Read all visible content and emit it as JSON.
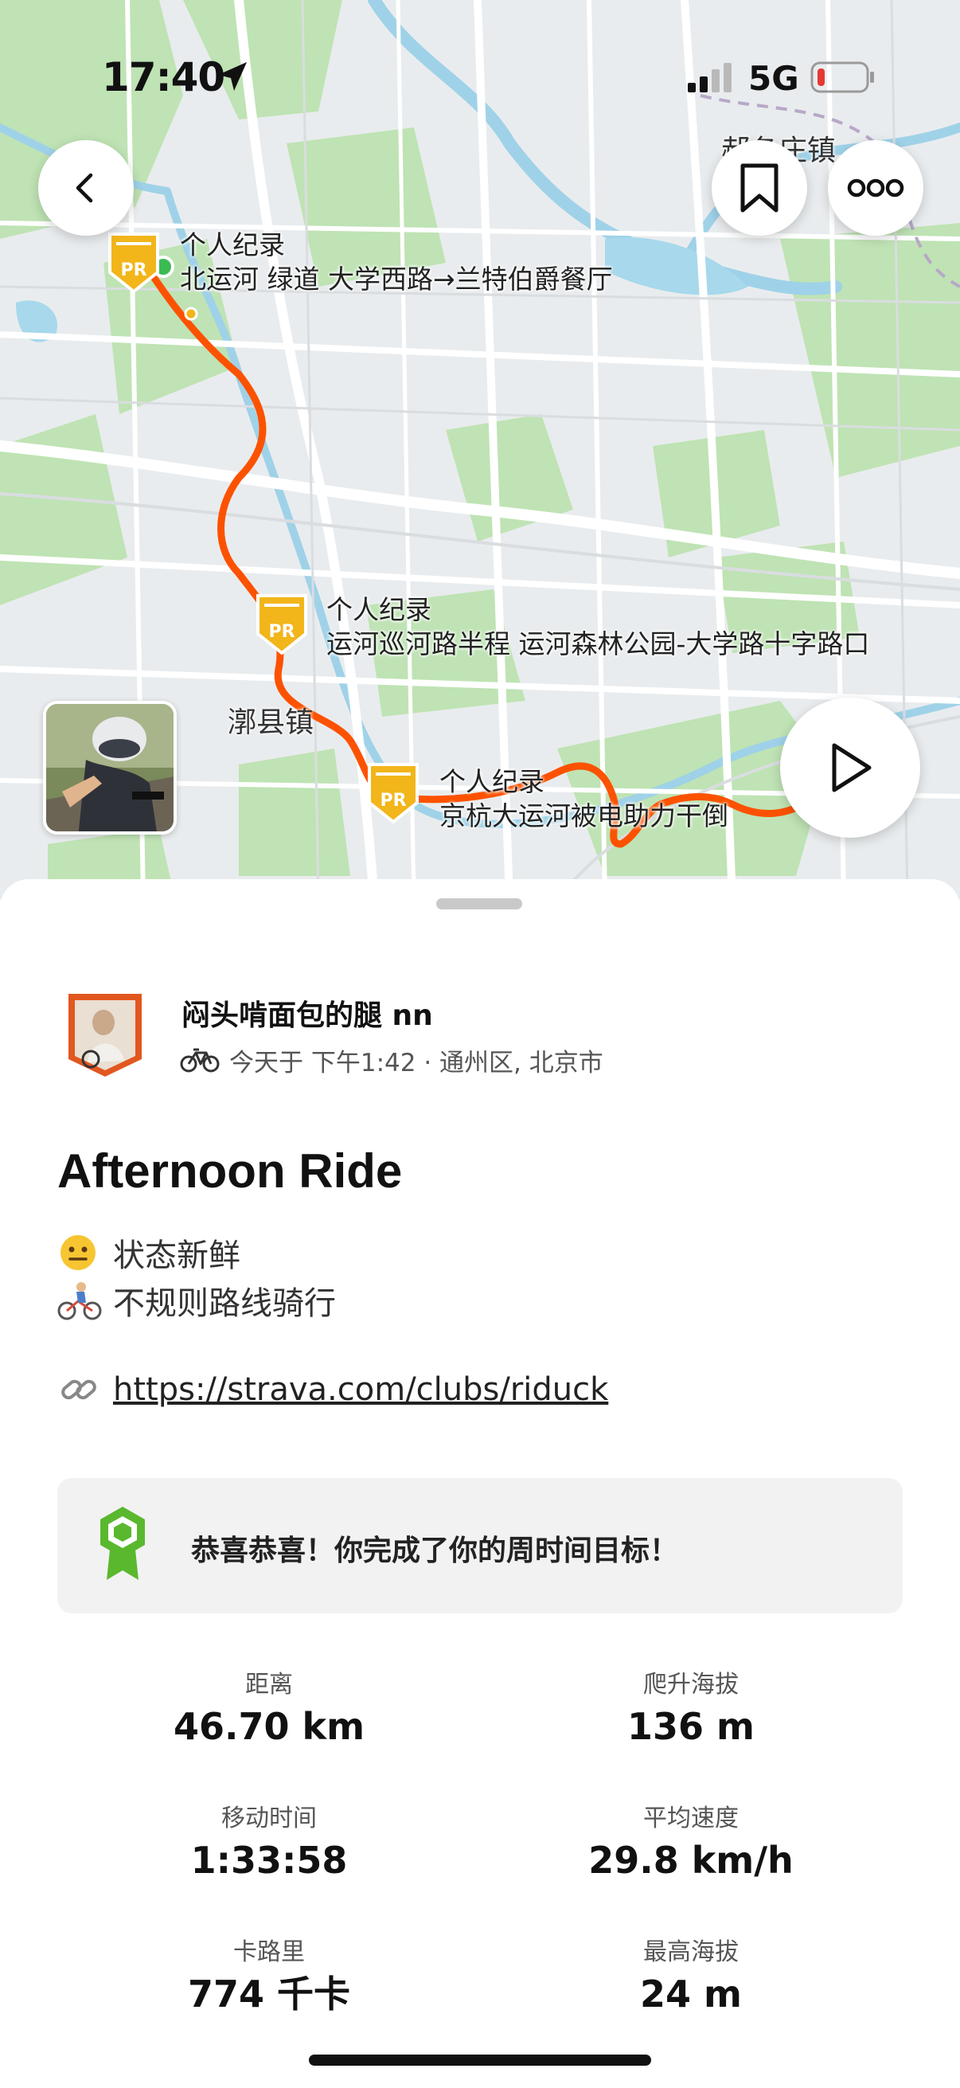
{
  "status_bar": {
    "time": "17:40",
    "network": "5G"
  },
  "map": {
    "pr_segments": [
      {
        "badge": "PR",
        "title": "个人纪录",
        "segment": "北运河 绿道 大学西路→兰特伯爵餐厅"
      },
      {
        "badge": "PR",
        "title": "个人纪录",
        "segment": "运河巡河路半程 运河森林公园-大学路十字路口"
      },
      {
        "badge": "PR",
        "title": "个人纪录",
        "segment": "京杭大运河被电助力干倒"
      }
    ],
    "towns": {
      "top_right": "郝各庄镇",
      "center": "漷县镇"
    },
    "route_color": "#fc5200"
  },
  "athlete": {
    "name": "闷头啃面包的腿 nn",
    "meta": "今天于 下午1:42 · 通州区, 北京市"
  },
  "activity": {
    "title": "Afternoon Ride",
    "description": [
      "状态新鲜",
      "不规则路线骑行"
    ],
    "link": "https://strava.com/clubs/riduck"
  },
  "goal": {
    "text": "恭喜恭喜！你完成了你的周时间目标！"
  },
  "stats": [
    {
      "label": "距离",
      "value": "46.70 km"
    },
    {
      "label": "爬升海拔",
      "value": "136 m"
    },
    {
      "label": "移动时间",
      "value": "1:33:58"
    },
    {
      "label": "平均速度",
      "value": "29.8 km/h"
    },
    {
      "label": "卡路里",
      "value": "774 千卡"
    },
    {
      "label": "最高海拔",
      "value": "24 m"
    }
  ],
  "colors": {
    "accent": "#fc5200",
    "goal_green": "#5ab82e",
    "pr_gold": "#f2b51a"
  }
}
